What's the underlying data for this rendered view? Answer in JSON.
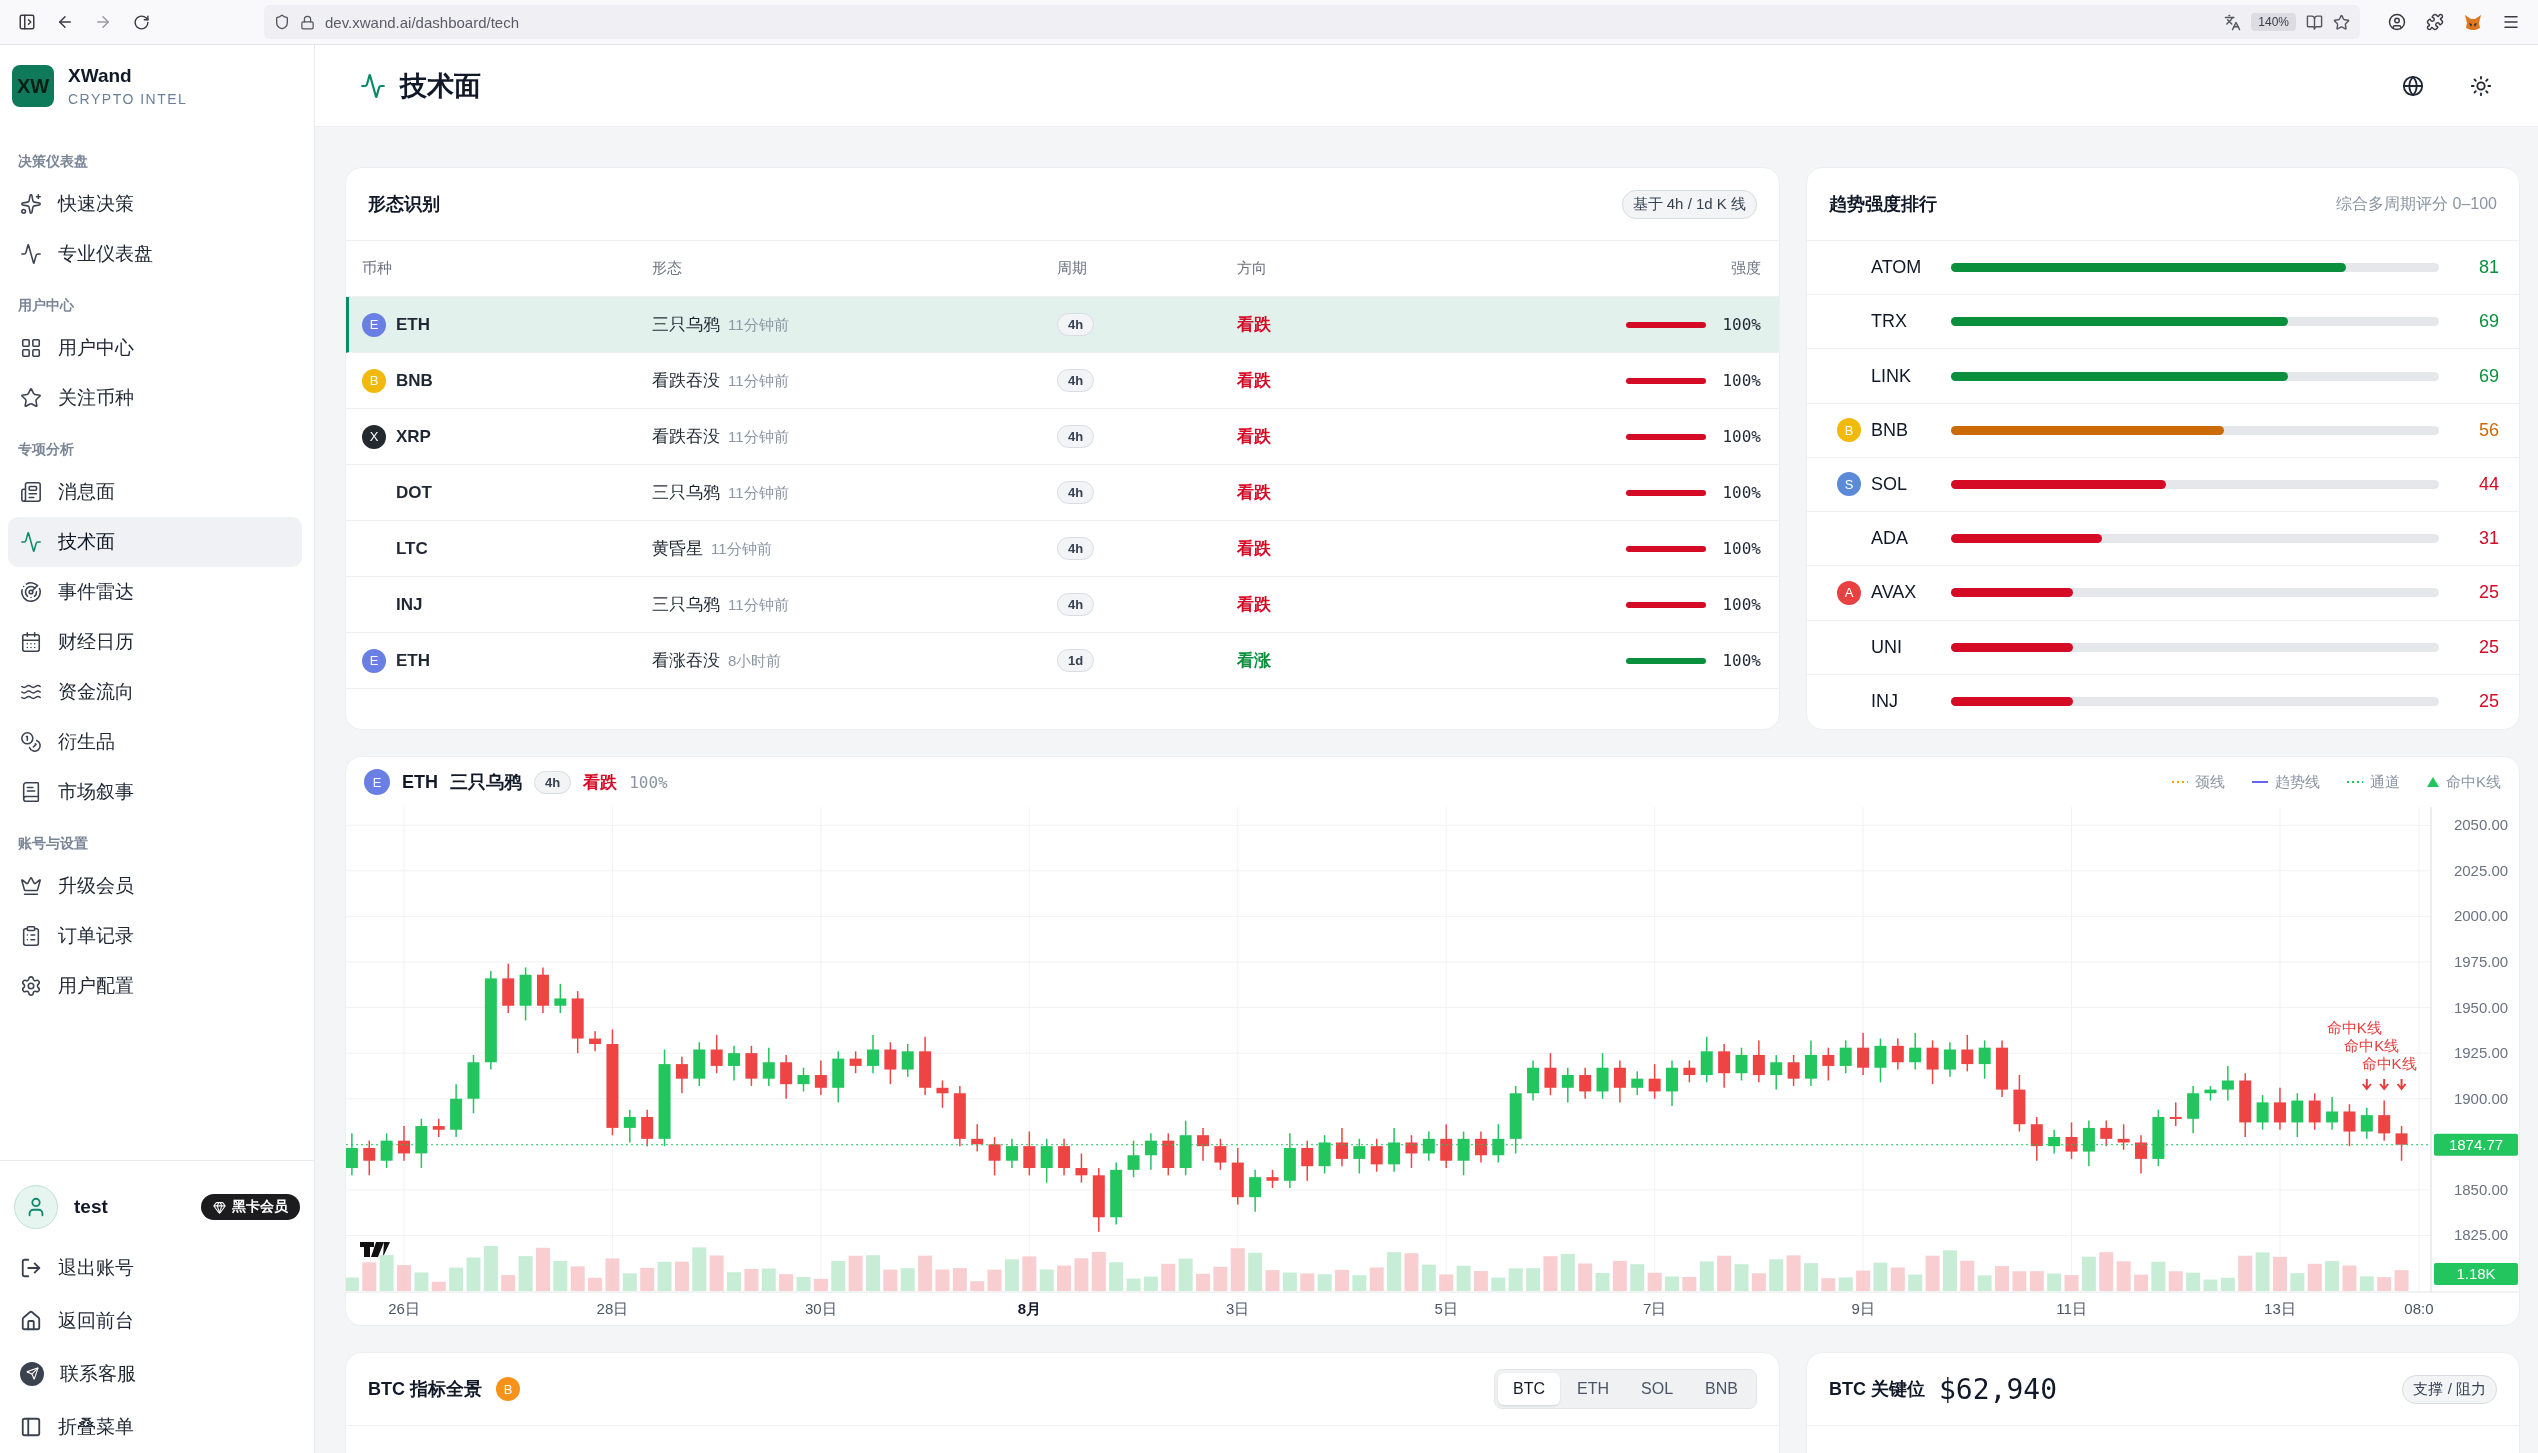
{
  "browser": {
    "url": "dev.xwand.ai/dashboard/tech",
    "zoom": "140%"
  },
  "brand": {
    "logo": "XW",
    "name": "XWand",
    "tagline": "CRYPTO INTEL"
  },
  "sidebar": {
    "sections": [
      {
        "title": "决策仪表盘",
        "items": [
          {
            "label": "快速决策",
            "selected": false
          },
          {
            "label": "专业仪表盘",
            "selected": false
          }
        ]
      },
      {
        "title": "用户中心",
        "items": [
          {
            "label": "用户中心",
            "selected": false
          },
          {
            "label": "关注币种",
            "selected": false
          }
        ]
      },
      {
        "title": "专项分析",
        "items": [
          {
            "label": "消息面",
            "selected": false
          },
          {
            "label": "技术面",
            "selected": true
          },
          {
            "label": "事件雷达",
            "selected": false
          },
          {
            "label": "财经日历",
            "selected": false
          },
          {
            "label": "资金流向",
            "selected": false
          },
          {
            "label": "衍生品",
            "selected": false
          },
          {
            "label": "市场叙事",
            "selected": false
          }
        ]
      },
      {
        "title": "账号与设置",
        "items": [
          {
            "label": "升级会员",
            "selected": false
          },
          {
            "label": "订单记录",
            "selected": false
          },
          {
            "label": "用户配置",
            "selected": false
          }
        ]
      }
    ],
    "user": {
      "name": "test",
      "badge": "黑卡会员"
    },
    "footer_items": [
      "退出账号",
      "返回前台",
      "联系客服",
      "折叠菜单"
    ]
  },
  "header": {
    "title": "技术面"
  },
  "patterns": {
    "title": "形态识别",
    "badge": "基于 4h / 1d K 线",
    "columns": [
      "币种",
      "形态",
      "周期",
      "方向",
      "强度"
    ],
    "rows": [
      {
        "coin": "ETH",
        "avatar": {
          "letter": "E",
          "color": "#6a7fe3"
        },
        "pattern": "三只乌鸦",
        "time": "11分钟前",
        "period": "4h",
        "direction": "看跌",
        "kind": "bearish",
        "level": 1,
        "strength": "100%",
        "selected": true
      },
      {
        "coin": "BNB",
        "avatar": {
          "letter": "B",
          "color": "#f0b90b"
        },
        "pattern": "看跌吞没",
        "time": "11分钟前",
        "period": "4h",
        "direction": "看跌",
        "kind": "bearish",
        "level": 1,
        "strength": "100%",
        "selected": false
      },
      {
        "coin": "XRP",
        "avatar": {
          "letter": "X",
          "color": "#23292f"
        },
        "pattern": "看跌吞没",
        "time": "11分钟前",
        "period": "4h",
        "direction": "看跌",
        "kind": "bearish",
        "level": 1,
        "strength": "100%",
        "selected": false
      },
      {
        "coin": "DOT",
        "pattern": "三只乌鸦",
        "time": "11分钟前",
        "period": "4h",
        "direction": "看跌",
        "kind": "bearish",
        "level": 1,
        "strength": "100%",
        "selected": false
      },
      {
        "coin": "LTC",
        "pattern": "黄昏星",
        "time": "11分钟前",
        "period": "4h",
        "direction": "看跌",
        "kind": "bearish",
        "level": 1,
        "strength": "100%",
        "selected": false
      },
      {
        "coin": "INJ",
        "pattern": "三只乌鸦",
        "time": "11分钟前",
        "period": "4h",
        "direction": "看跌",
        "kind": "bearish",
        "level": 1,
        "strength": "100%",
        "selected": false
      },
      {
        "coin": "ETH",
        "avatar": {
          "letter": "E",
          "color": "#6a7fe3"
        },
        "pattern": "看涨吞没",
        "time": "8小时前",
        "period": "1d",
        "direction": "看涨",
        "kind": "bullish",
        "level": 1,
        "strength": "100%",
        "selected": false
      }
    ]
  },
  "trend": {
    "title": "趋势强度排行",
    "subtitle": "综合多周期评分 0–100",
    "rows": [
      {
        "coin": "ATOM",
        "level": 0.81,
        "score": "81",
        "color": "#0a8f3c"
      },
      {
        "coin": "TRX",
        "level": 0.69,
        "score": "69",
        "color": "#0a8f3c"
      },
      {
        "coin": "LINK",
        "level": 0.69,
        "score": "69",
        "color": "#0a8f3c"
      },
      {
        "coin": "BNB",
        "avatar": {
          "letter": "B",
          "color": "#f0b90b"
        },
        "level": 0.56,
        "score": "56",
        "color": "#cc6a05"
      },
      {
        "coin": "SOL",
        "avatar": {
          "letter": "S",
          "color": "#5b8ad8"
        },
        "level": 0.44,
        "score": "44",
        "color": "#d50b26"
      },
      {
        "coin": "ADA",
        "level": 0.31,
        "score": "31",
        "color": "#d50b26"
      },
      {
        "coin": "AVAX",
        "avatar": {
          "letter": "A",
          "color": "#e84142"
        },
        "level": 0.25,
        "score": "25",
        "color": "#d50b26"
      },
      {
        "coin": "UNI",
        "level": 0.25,
        "score": "25",
        "color": "#d50b26"
      },
      {
        "coin": "INJ",
        "level": 0.25,
        "score": "25",
        "color": "#d50b26"
      }
    ]
  },
  "chart": {
    "coin": "ETH",
    "avatar": {
      "letter": "E",
      "color": "#6a7fe3"
    },
    "pattern": "三只乌鸦",
    "period": "4h",
    "direction": "看跌",
    "kind": "bearish",
    "strength": "100%",
    "legend": [
      {
        "label": "颈线",
        "kind": "dotted",
        "color": "#f59e0b"
      },
      {
        "label": "趋势线",
        "kind": "solid",
        "color": "#6366f1"
      },
      {
        "label": "通道",
        "kind": "dotted",
        "color": "#22c55e"
      },
      {
        "label": "命中K线",
        "kind": "triangle",
        "color": "#22c55e"
      }
    ],
    "chart_data": {
      "type": "candlestick",
      "ylim": [
        1794,
        2060
      ],
      "grid": true,
      "categories": [
        null,
        null,
        null,
        "26日",
        null,
        null,
        null,
        null,
        null,
        null,
        null,
        null,
        null,
        null,
        null,
        "28日",
        null,
        null,
        null,
        null,
        null,
        null,
        null,
        null,
        null,
        null,
        null,
        "30日",
        null,
        null,
        null,
        null,
        null,
        null,
        null,
        null,
        null,
        null,
        null,
        "8月",
        null,
        null,
        null,
        null,
        null,
        null,
        null,
        null,
        null,
        null,
        null,
        "3日",
        null,
        null,
        null,
        null,
        null,
        null,
        null,
        null,
        null,
        null,
        null,
        "5日",
        null,
        null,
        null,
        null,
        null,
        null,
        null,
        null,
        null,
        null,
        null,
        "7日",
        null,
        null,
        null,
        null,
        null,
        null,
        null,
        null,
        null,
        null,
        null,
        "9日",
        null,
        null,
        null,
        null,
        null,
        null,
        null,
        null,
        null,
        null,
        null,
        "11日",
        null,
        null,
        null,
        null,
        null,
        null,
        null,
        null,
        null,
        null,
        null,
        "13日",
        null,
        null,
        null,
        null,
        null,
        null,
        null,
        "08:0"
      ],
      "ohlc": [
        [
          1862,
          1881,
          1858,
          1873
        ],
        [
          1873,
          1877,
          1858,
          1866
        ],
        [
          1866,
          1881,
          1862,
          1877
        ],
        [
          1877,
          1885,
          1866,
          1870
        ],
        [
          1870,
          1889,
          1862,
          1885
        ],
        [
          1885,
          1889,
          1879,
          1883
        ],
        [
          1883,
          1908,
          1879,
          1900
        ],
        [
          1900,
          1924,
          1892,
          1920
        ],
        [
          1920,
          1970,
          1916,
          1966
        ],
        [
          1966,
          1974,
          1947,
          1951
        ],
        [
          1951,
          1972,
          1943,
          1968
        ],
        [
          1968,
          1972,
          1947,
          1951
        ],
        [
          1951,
          1963,
          1947,
          1955
        ],
        [
          1955,
          1959,
          1925,
          1933
        ],
        [
          1933,
          1937,
          1926,
          1930
        ],
        [
          1930,
          1938,
          1880,
          1884
        ],
        [
          1884,
          1894,
          1876,
          1890
        ],
        [
          1890,
          1894,
          1874,
          1878
        ],
        [
          1878,
          1927,
          1874,
          1919
        ],
        [
          1919,
          1923,
          1903,
          1911
        ],
        [
          1911,
          1931,
          1907,
          1927
        ],
        [
          1927,
          1935,
          1914,
          1918
        ],
        [
          1918,
          1929,
          1910,
          1925
        ],
        [
          1925,
          1929,
          1907,
          1911
        ],
        [
          1911,
          1928,
          1907,
          1920
        ],
        [
          1920,
          1924,
          1900,
          1908
        ],
        [
          1908,
          1917,
          1904,
          1913
        ],
        [
          1913,
          1921,
          1902,
          1906
        ],
        [
          1906,
          1926,
          1898,
          1922
        ],
        [
          1922,
          1926,
          1914,
          1918
        ],
        [
          1918,
          1935,
          1914,
          1927
        ],
        [
          1927,
          1931,
          1908,
          1916
        ],
        [
          1916,
          1930,
          1912,
          1926
        ],
        [
          1926,
          1934,
          1902,
          1906
        ],
        [
          1906,
          1910,
          1895,
          1903
        ],
        [
          1903,
          1907,
          1874,
          1878
        ],
        [
          1878,
          1886,
          1871,
          1875
        ],
        [
          1875,
          1879,
          1858,
          1866
        ],
        [
          1866,
          1878,
          1862,
          1874
        ],
        [
          1874,
          1882,
          1858,
          1862
        ],
        [
          1862,
          1878,
          1854,
          1874
        ],
        [
          1874,
          1878,
          1858,
          1862
        ],
        [
          1862,
          1870,
          1854,
          1858
        ],
        [
          1858,
          1862,
          1827,
          1835
        ],
        [
          1835,
          1865,
          1831,
          1861
        ],
        [
          1861,
          1877,
          1857,
          1869
        ],
        [
          1869,
          1881,
          1861,
          1877
        ],
        [
          1877,
          1881,
          1858,
          1862
        ],
        [
          1862,
          1888,
          1858,
          1880
        ],
        [
          1880,
          1884,
          1866,
          1874
        ],
        [
          1874,
          1878,
          1861,
          1865
        ],
        [
          1865,
          1873,
          1842,
          1846
        ],
        [
          1846,
          1861,
          1838,
          1857
        ],
        [
          1857,
          1861,
          1851,
          1855
        ],
        [
          1855,
          1881,
          1851,
          1873
        ],
        [
          1873,
          1877,
          1855,
          1863
        ],
        [
          1863,
          1880,
          1859,
          1876
        ],
        [
          1876,
          1884,
          1863,
          1867
        ],
        [
          1867,
          1878,
          1859,
          1874
        ],
        [
          1874,
          1878,
          1860,
          1864
        ],
        [
          1864,
          1884,
          1860,
          1876
        ],
        [
          1876,
          1880,
          1862,
          1870
        ],
        [
          1870,
          1882,
          1866,
          1878
        ],
        [
          1878,
          1886,
          1862,
          1866
        ],
        [
          1866,
          1882,
          1858,
          1878
        ],
        [
          1878,
          1882,
          1865,
          1869
        ],
        [
          1869,
          1886,
          1865,
          1878
        ],
        [
          1878,
          1907,
          1870,
          1903
        ],
        [
          1903,
          1921,
          1899,
          1917
        ],
        [
          1917,
          1925,
          1902,
          1906
        ],
        [
          1906,
          1917,
          1898,
          1913
        ],
        [
          1913,
          1917,
          1900,
          1904
        ],
        [
          1904,
          1925,
          1900,
          1917
        ],
        [
          1917,
          1921,
          1898,
          1906
        ],
        [
          1906,
          1915,
          1902,
          1911
        ],
        [
          1911,
          1919,
          1900,
          1904
        ],
        [
          1904,
          1921,
          1896,
          1917
        ],
        [
          1917,
          1921,
          1909,
          1913
        ],
        [
          1913,
          1934,
          1909,
          1926
        ],
        [
          1926,
          1930,
          1906,
          1914
        ],
        [
          1914,
          1928,
          1910,
          1924
        ],
        [
          1924,
          1932,
          1909,
          1913
        ],
        [
          1913,
          1924,
          1905,
          1920
        ],
        [
          1920,
          1924,
          1907,
          1911
        ],
        [
          1911,
          1932,
          1907,
          1924
        ],
        [
          1924,
          1928,
          1910,
          1918
        ],
        [
          1918,
          1932,
          1914,
          1928
        ],
        [
          1928,
          1936,
          1913,
          1917
        ],
        [
          1917,
          1933,
          1909,
          1929
        ],
        [
          1929,
          1933,
          1916,
          1920
        ],
        [
          1920,
          1936,
          1916,
          1928
        ],
        [
          1928,
          1932,
          1908,
          1916
        ],
        [
          1916,
          1931,
          1912,
          1927
        ],
        [
          1927,
          1935,
          1915,
          1919
        ],
        [
          1919,
          1932,
          1911,
          1928
        ],
        [
          1928,
          1932,
          1901,
          1905
        ],
        [
          1905,
          1913,
          1882,
          1886
        ],
        [
          1886,
          1890,
          1866,
          1874
        ],
        [
          1874,
          1883,
          1870,
          1879
        ],
        [
          1879,
          1887,
          1867,
          1871
        ],
        [
          1871,
          1888,
          1863,
          1884
        ],
        [
          1884,
          1888,
          1874,
          1878
        ],
        [
          1878,
          1886,
          1872,
          1876
        ],
        [
          1876,
          1880,
          1859,
          1867
        ],
        [
          1867,
          1894,
          1863,
          1890
        ],
        [
          1890,
          1898,
          1885,
          1889
        ],
        [
          1889,
          1907,
          1881,
          1903
        ],
        [
          1903,
          1907,
          1899,
          1905
        ],
        [
          1905,
          1918,
          1899,
          1910
        ],
        [
          1910,
          1914,
          1879,
          1887
        ],
        [
          1887,
          1902,
          1883,
          1898
        ],
        [
          1898,
          1906,
          1883,
          1887
        ],
        [
          1887,
          1903,
          1879,
          1899
        ],
        [
          1899,
          1903,
          1883,
          1887
        ],
        [
          1887,
          1901,
          1883,
          1893
        ],
        [
          1893,
          1897,
          1874,
          1882
        ],
        [
          1882,
          1895,
          1878,
          1891
        ],
        [
          1891,
          1899,
          1877,
          1881
        ],
        [
          1881,
          1885,
          1866,
          1874.77
        ],
        null
      ],
      "yticks": [
        {
          "value": 2050,
          "label": "2050.00"
        },
        {
          "value": 2025,
          "label": "2025.00"
        },
        {
          "value": 2000,
          "label": "2000.00"
        },
        {
          "value": 1975,
          "label": "1975.00"
        },
        {
          "value": 1950,
          "label": "1950.00"
        },
        {
          "value": 1925,
          "label": "1925.00"
        },
        {
          "value": 1900,
          "label": "1900.00"
        },
        {
          "value": 1850,
          "label": "1850.00"
        },
        {
          "value": 1825,
          "label": "1825.00"
        }
      ],
      "annotations": [
        "命中K线",
        "命中K线",
        "命中K线"
      ]
    },
    "axis_label_major": [
      false,
      false,
      false,
      true,
      false,
      false,
      false,
      false,
      false,
      false,
      false
    ],
    "last_price": "1874.77",
    "last_volume": "1.18K"
  },
  "indicators": {
    "title": "BTC 指标全景",
    "avatar": {
      "letter": "B",
      "color": "#f7931a"
    },
    "tabs": [
      {
        "label": "BTC",
        "selected": true
      },
      {
        "label": "ETH",
        "selected": false
      },
      {
        "label": "SOL",
        "selected": false
      },
      {
        "label": "BNB",
        "selected": false
      }
    ]
  },
  "key_levels": {
    "title": "BTC 关键位",
    "price": "$62,940",
    "badge": "支撑 / 阻力"
  }
}
